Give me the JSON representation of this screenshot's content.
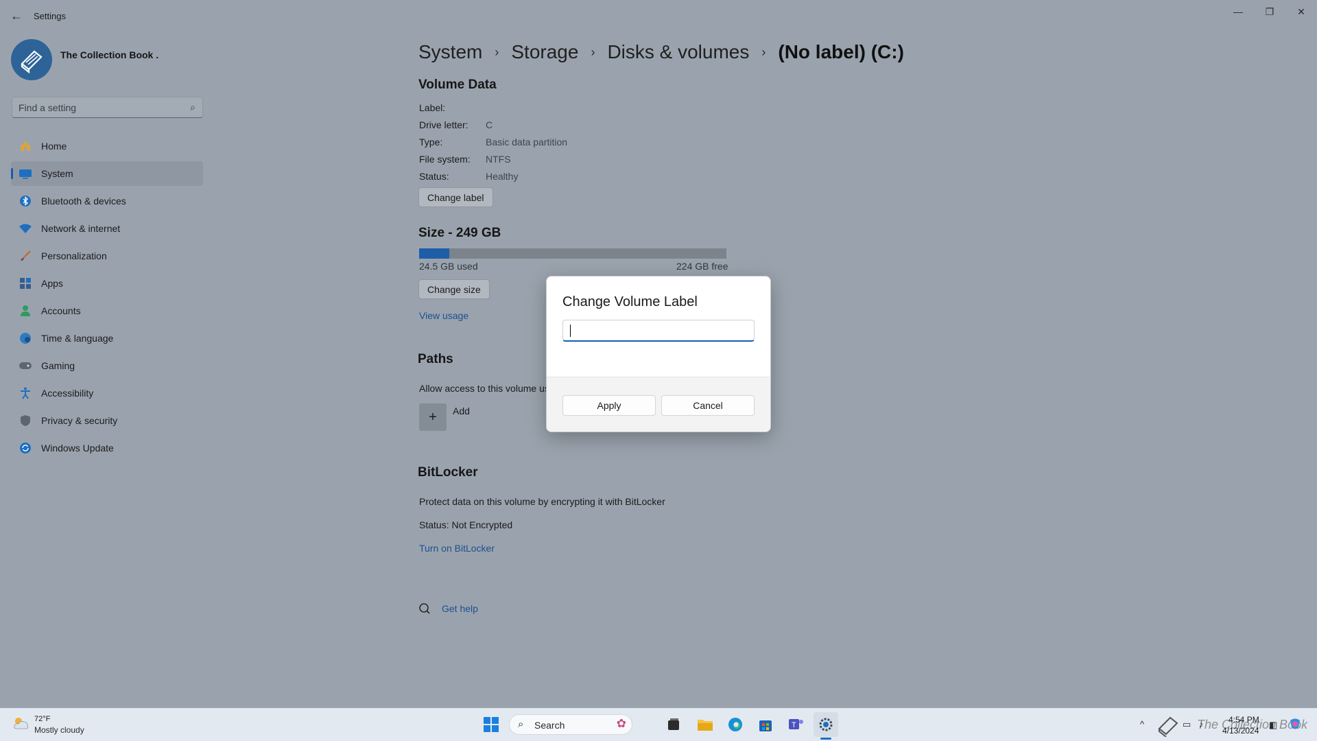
{
  "window": {
    "title": "Settings",
    "controls": {
      "minimize": "—",
      "maximize": "❐",
      "close": "✕"
    }
  },
  "profile": {
    "name": "The Collection Book ."
  },
  "search": {
    "placeholder": "Find a setting"
  },
  "sidebar": {
    "items": [
      {
        "label": "Home",
        "icon": "home-icon",
        "color": "#d9a441"
      },
      {
        "label": "System",
        "icon": "monitor-icon",
        "color": "#1e6fc0",
        "selected": true
      },
      {
        "label": "Bluetooth & devices",
        "icon": "bluetooth-icon",
        "color": "#1e6fc0"
      },
      {
        "label": "Network & internet",
        "icon": "wifi-icon",
        "color": "#1e6fc0"
      },
      {
        "label": "Personalization",
        "icon": "brush-icon",
        "color": "#c46b2d"
      },
      {
        "label": "Apps",
        "icon": "apps-icon",
        "color": "#3a5c8a"
      },
      {
        "label": "Accounts",
        "icon": "person-icon",
        "color": "#2f9a63"
      },
      {
        "label": "Time & language",
        "icon": "globe-clock-icon",
        "color": "#2a7cc4"
      },
      {
        "label": "Gaming",
        "icon": "gamepad-icon",
        "color": "#5c6670"
      },
      {
        "label": "Accessibility",
        "icon": "accessibility-icon",
        "color": "#1e6fc0"
      },
      {
        "label": "Privacy & security",
        "icon": "shield-icon",
        "color": "#5c6670"
      },
      {
        "label": "Windows Update",
        "icon": "sync-icon",
        "color": "#1e6fc0"
      }
    ]
  },
  "breadcrumb": {
    "items": [
      "System",
      "Storage",
      "Disks & volumes"
    ],
    "current": "(No label) (C:)"
  },
  "volume": {
    "heading": "Volume Data",
    "rows": [
      {
        "key": "Label:",
        "value": ""
      },
      {
        "key": "Drive letter:",
        "value": "C"
      },
      {
        "key": "Type:",
        "value": "Basic data partition"
      },
      {
        "key": "File system:",
        "value": "NTFS"
      },
      {
        "key": "Status:",
        "value": "Healthy"
      }
    ],
    "change_label_button": "Change label"
  },
  "size": {
    "heading": "Size - 249 GB",
    "used_fraction": 0.098,
    "used": "24.5 GB used",
    "free": "224 GB free",
    "change_size_button": "Change size",
    "view_usage_link": "View usage"
  },
  "paths": {
    "heading": "Paths",
    "description": "Allow access to this volume us",
    "add_label": "Add"
  },
  "bitlocker": {
    "heading": "BitLocker",
    "description": "Protect data on this volume by encrypting it with BitLocker",
    "status": "Status: Not Encrypted",
    "turn_on_link": "Turn on BitLocker"
  },
  "help": {
    "label": "Get help"
  },
  "dialog": {
    "title": "Change Volume Label",
    "input_value": "",
    "apply": "Apply",
    "cancel": "Cancel"
  },
  "taskbar": {
    "weather_temp": "72°F",
    "weather_desc": "Mostly cloudy",
    "search_label": "Search",
    "time": "4:54 PM",
    "date": "4/13/2024",
    "watermark": "The Collection Book"
  }
}
